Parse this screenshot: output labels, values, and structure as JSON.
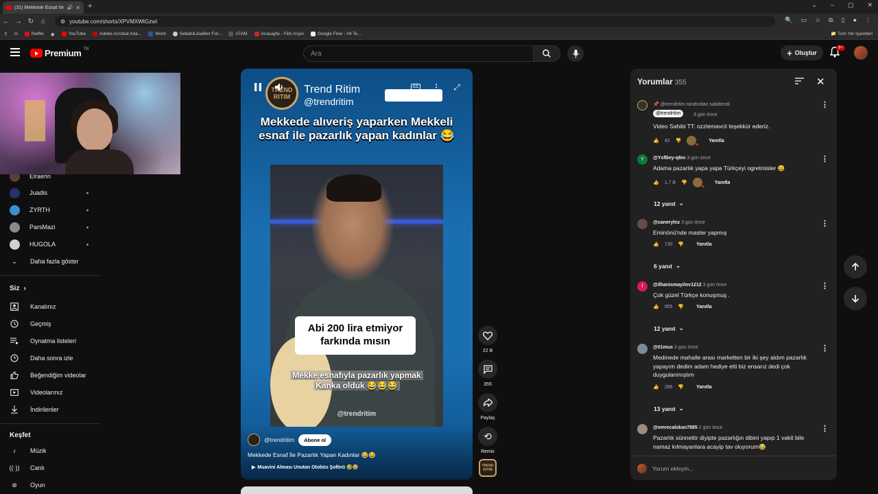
{
  "browser": {
    "tab_title": "(31) Mekkede Esnaf İle Pazar...",
    "url": "youtube.com/shorts/XPVMXWtGzwI",
    "bookmarks": [
      "Netflix",
      "YouTube",
      "Adobe Acrobat Ana...",
      "Word",
      "Sebah&Joaillier Fot...",
      "ATAM",
      "Anasayfa - Film Arşivi",
      "Google Flow - 04 Te..."
    ],
    "bookmarks_all": "Tüm Yer İşaretleri"
  },
  "header": {
    "logo_text": "Premium",
    "logo_country": "TR",
    "search_placeholder": "Ara",
    "create_label": "Oluştur",
    "notif_count": "9+"
  },
  "sidebar": {
    "subscriptions": [
      {
        "name": "Elraenn",
        "color": "#5a3e36"
      },
      {
        "name": "Juadis",
        "color": "#2b2f6a"
      },
      {
        "name": "ZYRTH",
        "color": "#3a8fd0"
      },
      {
        "name": "ParsMazi",
        "color": "#8a8a8a"
      },
      {
        "name": "HUGOLA",
        "color": "#cfcfcf"
      }
    ],
    "show_more": "Daha fazla göster",
    "you_header": "Siz",
    "you_items": [
      {
        "label": "Kanalınız",
        "icon": "channel-icon"
      },
      {
        "label": "Geçmiş",
        "icon": "history-icon"
      },
      {
        "label": "Oynatma listeleri",
        "icon": "playlist-icon"
      },
      {
        "label": "Daha sonra izle",
        "icon": "clock-icon"
      },
      {
        "label": "Beğendiğim videolar",
        "icon": "like-icon"
      },
      {
        "label": "Videolarınız",
        "icon": "video-icon"
      },
      {
        "label": "İndirilenler",
        "icon": "download-icon"
      }
    ],
    "explore_header": "Keşfet",
    "explore_items": [
      {
        "label": "Müzik",
        "icon": "music-icon"
      },
      {
        "label": "Canlı",
        "icon": "live-icon"
      },
      {
        "label": "Oyun",
        "icon": "gaming-icon"
      }
    ]
  },
  "video": {
    "brand_line1": "TREND",
    "brand_line2": "RITIM",
    "brand_name": "Trend Ritim",
    "brand_handle": "@trendritim",
    "headline": "Mekkede alıveriş yaparken Mekkeli esnaf ile pazarlık yapan kadınlar 😂",
    "bubble": "Abi 200 lira etmiyor farkında mısın",
    "caption_line1": "Mekke esnafıyla pazarlık yapmak",
    "caption_line2": "Kanka olduk 😂😂😂",
    "watermark": "@trendritim",
    "channel_handle": "@trendritim",
    "subscribe_label": "Abone ol",
    "title": "Mekkede Esnaf İle Pazarlık Yapan Kadınlar 😂😂",
    "related": "Muavini Alması Unutan Otobüs Şoförü 🤣😂"
  },
  "actions": {
    "like_count": "22 B",
    "comment_count": "355",
    "share_label": "Paylaş",
    "remix_label": "Remix"
  },
  "comments": {
    "title": "Yorumlar",
    "count": "355",
    "pinned_by": "@trendritim tarafından sabitlendi",
    "items": [
      {
        "author": "@trendritim",
        "time": "3 gün önce",
        "text": "Video Sahibi TT: ozzlemavcii teşekkür ederiz.",
        "likes": "42",
        "avatar_color": "#3a3226",
        "initial": ""
      },
      {
        "author": "@YsfBey-q6m",
        "time": "3 gün önce",
        "text": "Adama pazarlık yapa yapa Türkçeyi ogretmisler 😄",
        "likes": "1,7 B",
        "avatar_color": "#0b7a3e",
        "initial": "Y",
        "replies": "12 yanıt"
      },
      {
        "author": "@canerylnz",
        "time": "3 gün önce",
        "text": "Eminönü'nde master yapmış",
        "likes": "730",
        "avatar_color": "#6a4a44",
        "initial": "",
        "replies": "6 yanıt"
      },
      {
        "author": "@ilhanismayilov1212",
        "time": "3 gün önce",
        "text": "Çok güzel Türkçe konuşmuş .",
        "likes": "955",
        "avatar_color": "#d81b60",
        "initial": "İ",
        "replies": "12 yanıt"
      },
      {
        "author": "@01mus",
        "time": "3 gün önce",
        "text": "Medinede mahalle arası marketten bir iki şey aldım pazarlık yapayım dedim adam hediye etti biz ensarız dedi çok duygulanmıştım",
        "likes": "286",
        "avatar_color": "#7b8a95",
        "initial": "",
        "replies": "13 yanıt"
      },
      {
        "author": "@emrecalskan7885",
        "time": "2 gün önce",
        "text": "Pazarlık sünnettir diyipte pazarlığın dibini yapıp 1 vakit bile namaz kılmayanlara acayip tav oluyorum😂",
        "likes": "",
        "avatar_color": "#a08a80",
        "initial": ""
      }
    ],
    "reply_label": "Yanıtla",
    "input_placeholder": "Yorum ekleyin..."
  }
}
